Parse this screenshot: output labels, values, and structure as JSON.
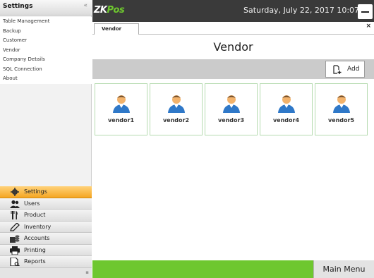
{
  "sidebar": {
    "title": "Settings",
    "collapse_glyph": "«",
    "items": [
      {
        "label": "Table Management"
      },
      {
        "label": "Backup"
      },
      {
        "label": "Customer"
      },
      {
        "label": "Vendor"
      },
      {
        "label": "Company Details"
      },
      {
        "label": "SQL Connection"
      },
      {
        "label": "About"
      }
    ]
  },
  "nav": {
    "active_color": "#f5a623",
    "items": [
      {
        "label": "Settings",
        "icon": "gear-icon"
      },
      {
        "label": "Users",
        "icon": "users-icon"
      },
      {
        "label": "Product",
        "icon": "utensils-icon"
      },
      {
        "label": "Inventory",
        "icon": "pencil-icon"
      },
      {
        "label": "Accounts",
        "icon": "coins-icon"
      },
      {
        "label": "Printing",
        "icon": "printer-icon"
      },
      {
        "label": "Reports",
        "icon": "report-icon"
      }
    ]
  },
  "header": {
    "logo_zk": "ZK",
    "logo_pos": "Pos",
    "datetime": "Saturday, July 22, 2017 10:07",
    "bg_color": "#3a3a3a"
  },
  "tabs": [
    {
      "label": "Vendor"
    }
  ],
  "tab_close": "×",
  "page": {
    "title": "Vendor"
  },
  "toolbar": {
    "add_label": "Add"
  },
  "vendors": [
    {
      "name": "vendor1"
    },
    {
      "name": "vendor2"
    },
    {
      "name": "vendor3"
    },
    {
      "name": "vendor4"
    },
    {
      "name": "vendor5"
    }
  ],
  "footer": {
    "main_menu": "Main Menu",
    "bar_color": "#6ec72f"
  }
}
